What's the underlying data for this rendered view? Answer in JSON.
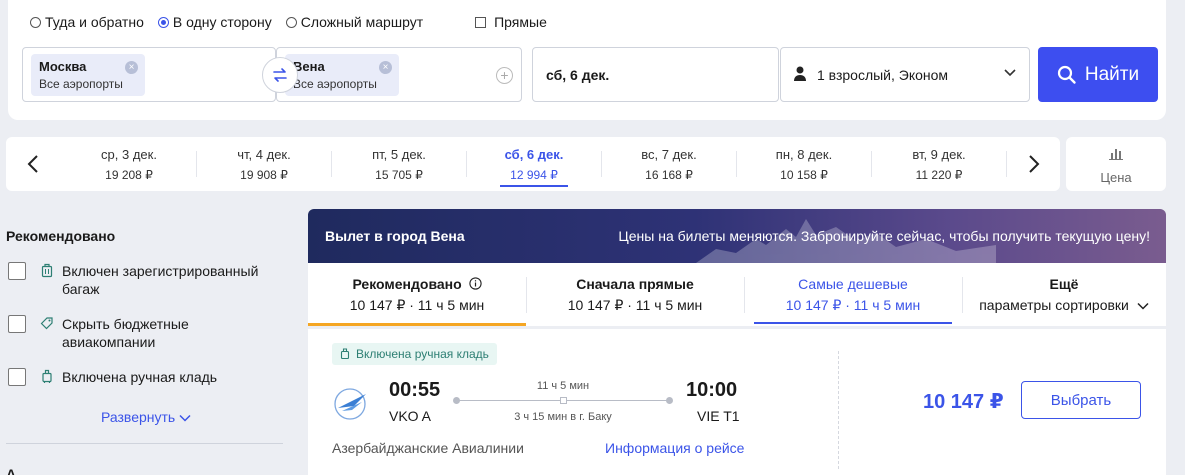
{
  "search": {
    "trip_types": [
      {
        "label": "Туда и обратно",
        "checked": false
      },
      {
        "label": "В одну сторону",
        "checked": true
      },
      {
        "label": "Сложный маршрут",
        "checked": false
      }
    ],
    "direct_label": "Прямые",
    "origin": {
      "city": "Москва",
      "airports": "Все аэропорты"
    },
    "destination": {
      "city": "Вена",
      "airports": "Все аэропорты"
    },
    "date": "сб, 6 дек.",
    "passengers": "1 взрослый, Эконом",
    "search_button": "Найти",
    "accent_color": "#3d4ef0"
  },
  "date_strip": {
    "days": [
      {
        "label": "ср, 3 дек.",
        "price": "19 208 ₽"
      },
      {
        "label": "чт, 4 дек.",
        "price": "19 908 ₽"
      },
      {
        "label": "пт, 5 дек.",
        "price": "15 705 ₽"
      },
      {
        "label": "сб, 6 дек.",
        "price": "12 994 ₽",
        "selected": true
      },
      {
        "label": "вс, 7 дек.",
        "price": "16 168 ₽"
      },
      {
        "label": "пн, 8 дек.",
        "price": "10 158 ₽"
      },
      {
        "label": "вт, 9 дек.",
        "price": "11 220 ₽"
      }
    ],
    "price_chart_label": "Цена"
  },
  "filters": {
    "title": "Рекомендовано",
    "items": [
      {
        "label": "Включен зарегистрированный багаж",
        "icon": "suitcase-icon"
      },
      {
        "label": "Скрыть бюджетные авиакомпании",
        "icon": "tag-icon"
      },
      {
        "label": "Включена ручная кладь",
        "icon": "hand-luggage-icon"
      }
    ],
    "expand_label": "Развернуть",
    "next_section": "А"
  },
  "results": {
    "banner_title": "Вылет в город Вена",
    "banner_note": "Цены на билеты меняются. Забронируйте сейчас, чтобы получить текущую цену!",
    "sort_tabs": [
      {
        "name": "Рекомендовано",
        "meta": "10 147 ₽ · 11 ч 5 мин"
      },
      {
        "name": "Сначала прямые",
        "meta": "10 147 ₽ · 11 ч 5 мин"
      },
      {
        "name": "Самые дешевые",
        "meta": "10 147 ₽ · 11 ч 5 мин"
      },
      {
        "name": "Ещё",
        "meta": "параметры сортировки"
      }
    ],
    "flight": {
      "baggage_tag": "Включена ручная кладь",
      "departure_time": "00:55",
      "departure_code": "VKO A",
      "arrival_time": "10:00",
      "arrival_code": "VIE T1",
      "duration": "11 ч 5 мин",
      "stopover": "3 ч 15 мин в г. Баку",
      "airline": "Азербайджанские Авиалинии",
      "info_link": "Информация о рейсе",
      "price": "10 147 ₽",
      "select_button": "Выбрать"
    }
  }
}
